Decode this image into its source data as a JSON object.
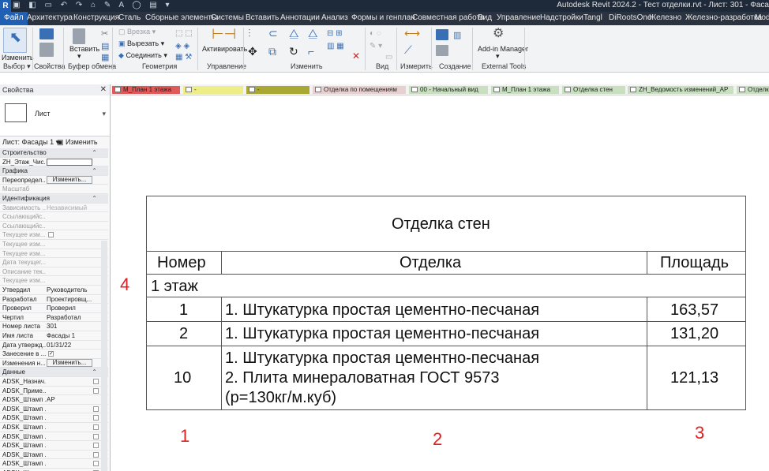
{
  "titlebar": {
    "logo": "R",
    "title": "Autodesk Revit 2024.2 - Тест отделки.rvt - Лист: 301 - Фаса"
  },
  "ribbon_tabs": [
    "Файл",
    "Архитектура",
    "Конструкция",
    "Сталь",
    "Сборные элементы",
    "Системы",
    "Вставить",
    "Аннотации",
    "Анализ",
    "Формы и генплан",
    "Совместная работа",
    "Вид",
    "Управление",
    "Надстройки",
    "Tangl",
    "DiRootsOne",
    "Железно",
    "Железно-разработка",
    "Modi"
  ],
  "ribbon": {
    "modify_label": "Изменить",
    "paste_label": "Вставить",
    "cut_label": "Вырезать",
    "join_label": "Соединить",
    "cope_label": "Врезка",
    "activate_label": "Активировать",
    "addin_label": "Add-in Manager",
    "groups": {
      "select": "Выбор",
      "properties": "Свойства",
      "clipboard": "Буфер обмена",
      "geometry": "Геометрия",
      "control": "Управление",
      "modify": "Изменить",
      "view": "Вид",
      "measure": "Измерить",
      "create": "Создание",
      "external": "External Tools"
    }
  },
  "properties": {
    "header": "Свойства",
    "type_name": "Лист",
    "instance_selector": "Лист: Фасады 1",
    "edit_type": "Изменить тип",
    "edit_button": "Изменить...",
    "rows": [
      {
        "key": "Строительство",
        "group": true
      },
      {
        "key": "ZH_Этаж_Чис...",
        "field": true
      },
      {
        "key": "Графика",
        "group": true
      },
      {
        "key": "Переопредел...",
        "button": true
      },
      {
        "key": "Масштаб",
        "dim": true
      },
      {
        "key": "Идентификация",
        "group": true
      },
      {
        "key": "Зависимость ...",
        "value": "Независимый",
        "dim": true
      },
      {
        "key": "Ссылающийс...",
        "dim": true
      },
      {
        "key": "Ссылающийс...",
        "dim": true
      },
      {
        "key": "Текущее изм...",
        "check": "",
        "dim": true
      },
      {
        "key": "Текущее изм...",
        "dim": true
      },
      {
        "key": "Текущее изм...",
        "dim": true
      },
      {
        "key": "Дата текущег...",
        "dim": true
      },
      {
        "key": "Описание тек...",
        "dim": true
      },
      {
        "key": "Текущее изм...",
        "dim": true
      },
      {
        "key": "Утвердил",
        "value": "Руководитель"
      },
      {
        "key": "Разработал",
        "value": "Проектировщ..."
      },
      {
        "key": "Проверил",
        "value": "Проверил"
      },
      {
        "key": "Чертил",
        "value": "Разработал"
      },
      {
        "key": "Номер листа",
        "value": "301"
      },
      {
        "key": "Имя листа",
        "value": "Фасады 1"
      },
      {
        "key": "Дата утвержд...",
        "value": "01/31/22"
      },
      {
        "key": "Занесение в ...",
        "check": "✓"
      },
      {
        "key": "Изменения н...",
        "button": true
      },
      {
        "key": "Данные",
        "group": true
      },
      {
        "key": "ADSK_Назнач...",
        "rcheck": true
      },
      {
        "key": "ADSK_Приме...",
        "rcheck": true
      },
      {
        "key": "ADSK_Штамп ...",
        "value": "АР"
      },
      {
        "key": "ADSK_Штамп ...",
        "rcheck": true
      },
      {
        "key": "ADSK_Штамп ...",
        "rcheck": true
      },
      {
        "key": "ADSK_Штамп ...",
        "rcheck": true
      },
      {
        "key": "ADSK_Штамп ...",
        "rcheck": true
      },
      {
        "key": "ADSK_Штамп ...",
        "rcheck": true
      },
      {
        "key": "ADSK_Штамп ...",
        "rcheck": true
      },
      {
        "key": "ADSK_Штамп ...",
        "rcheck": true
      },
      {
        "key": "ADSK_Штамп ...",
        "rcheck": true
      }
    ]
  },
  "view_tabs": [
    {
      "label": "M_План 1 этажа",
      "color": "#e05a5a"
    },
    {
      "label": "-",
      "color": "#eeee88"
    },
    {
      "label": "-",
      "color": "#a8a832"
    },
    {
      "label": "Отделка по помещениям",
      "color": "#e8d0d0"
    },
    {
      "label": "00 - Начальный вид",
      "color": "#c8e0c0"
    },
    {
      "label": "M_План 1 этажа",
      "color": "#c8e0c0"
    },
    {
      "label": "Отделка стен",
      "color": "#c8e0c0"
    },
    {
      "label": "ZH_Ведомость изменений_АР",
      "color": "#c8e0c0"
    },
    {
      "label": "Отделка",
      "color": "#c8e0c0"
    }
  ],
  "schedule": {
    "title": "Отделка стен",
    "columns": [
      "Номер",
      "Отделка",
      "Площадь"
    ],
    "group_label": "1 этаж",
    "rows": [
      {
        "number": "1",
        "finish": [
          "1. Штукатурка простая цементно-песчаная"
        ],
        "area": "163,57"
      },
      {
        "number": "2",
        "finish": [
          "1. Штукатурка простая цементно-песчаная"
        ],
        "area": "131,20"
      },
      {
        "number": "10",
        "finish": [
          "1. Штукатурка простая цементно-песчаная",
          "2. Плита минераловатная ГОСТ 9573",
          "(р=130кг/м.куб)"
        ],
        "area": "121,13"
      }
    ]
  },
  "annotations": [
    "4",
    "1",
    "2",
    "3"
  ],
  "colors": {
    "accent": "#1f5fb4",
    "annotation": "#e02020"
  }
}
